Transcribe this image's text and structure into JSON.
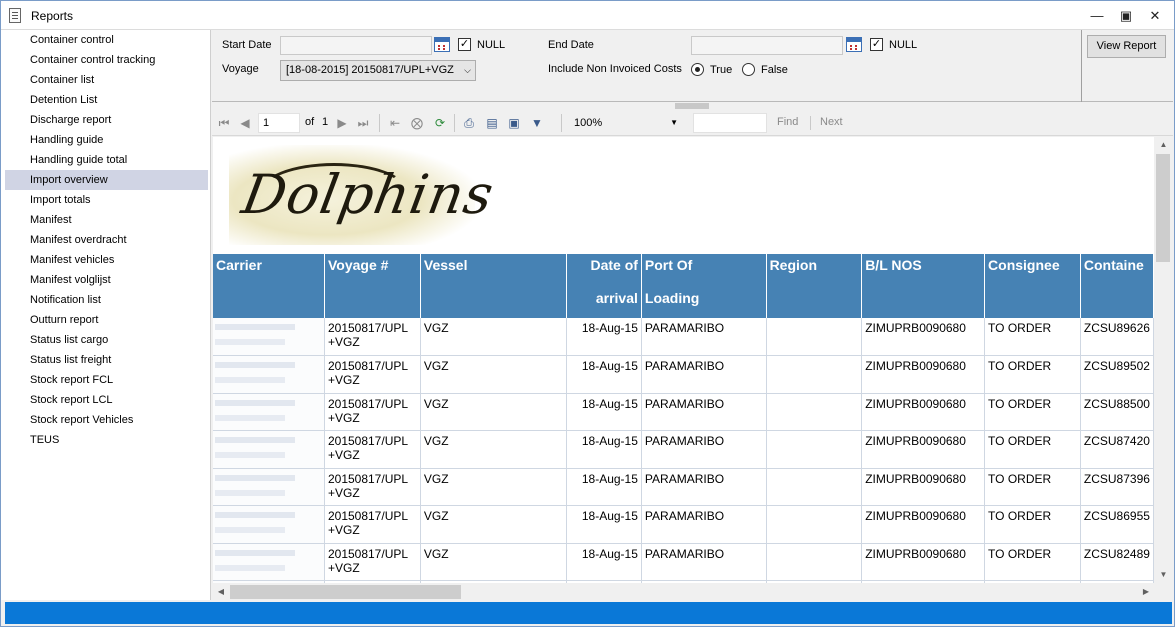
{
  "window": {
    "title": "Reports"
  },
  "sidebar": {
    "items": [
      {
        "label": "Container control"
      },
      {
        "label": "Container control tracking"
      },
      {
        "label": "Container list"
      },
      {
        "label": "Detention List"
      },
      {
        "label": "Discharge report"
      },
      {
        "label": "Handling guide"
      },
      {
        "label": "Handling guide total"
      },
      {
        "label": "Import overview",
        "selected": true
      },
      {
        "label": "Import totals"
      },
      {
        "label": "Manifest"
      },
      {
        "label": "Manifest overdracht"
      },
      {
        "label": "Manifest vehicles"
      },
      {
        "label": "Manifest volglijst"
      },
      {
        "label": "Notification list"
      },
      {
        "label": "Outturn report"
      },
      {
        "label": "Status list cargo"
      },
      {
        "label": "Status list freight"
      },
      {
        "label": "Stock report FCL"
      },
      {
        "label": "Stock report LCL"
      },
      {
        "label": "Stock report Vehicles"
      },
      {
        "label": "TEUS"
      }
    ]
  },
  "params": {
    "start_date_label": "Start Date",
    "start_date_value": "",
    "start_null_label": "NULL",
    "start_null_checked": true,
    "end_date_label": "End Date",
    "end_date_value": "",
    "end_null_label": "NULL",
    "end_null_checked": true,
    "voyage_label": "Voyage",
    "voyage_value": "[18-08-2015] 20150817/UPL+VGZ",
    "invoiced_label": "Include Non Invoiced Costs",
    "true_label": "True",
    "false_label": "False",
    "include_non_invoiced": true,
    "view_report_label": "View Report"
  },
  "toolbar": {
    "page_current": "1",
    "page_of_label": "of",
    "page_total": "1",
    "zoom": "100%",
    "find_value": "",
    "find_label": "Find",
    "next_label": "Next"
  },
  "report": {
    "logo_text": "Dolphins",
    "columns": [
      {
        "line1": "Carrier",
        "line2": ""
      },
      {
        "line1": "Voyage #",
        "line2": ""
      },
      {
        "line1": "Vessel",
        "line2": ""
      },
      {
        "line1": "Date of",
        "line2": "arrival"
      },
      {
        "line1": "Port Of",
        "line2": "Loading"
      },
      {
        "line1": "Region",
        "line2": ""
      },
      {
        "line1": "B/L NOS",
        "line2": ""
      },
      {
        "line1": "Consignee",
        "line2": ""
      },
      {
        "line1": "Containe",
        "line2": ""
      }
    ],
    "rows": [
      {
        "carrier": "",
        "voyage_l1": "20150817/UPL",
        "voyage_l2": "+VGZ",
        "vessel": "VGZ",
        "date": "18-Aug-15",
        "port": "PARAMARIBO",
        "region": "",
        "bl": "ZIMUPRB0090680",
        "consignee": "TO ORDER",
        "container": "ZCSU89626"
      },
      {
        "carrier": "",
        "voyage_l1": "20150817/UPL",
        "voyage_l2": "+VGZ",
        "vessel": "VGZ",
        "date": "18-Aug-15",
        "port": "PARAMARIBO",
        "region": "",
        "bl": "ZIMUPRB0090680",
        "consignee": "TO ORDER",
        "container": "ZCSU89502"
      },
      {
        "carrier": "",
        "voyage_l1": "20150817/UPL",
        "voyage_l2": "+VGZ",
        "vessel": "VGZ",
        "date": "18-Aug-15",
        "port": "PARAMARIBO",
        "region": "",
        "bl": "ZIMUPRB0090680",
        "consignee": "TO ORDER",
        "container": "ZCSU88500"
      },
      {
        "carrier": "",
        "voyage_l1": "20150817/UPL",
        "voyage_l2": "+VGZ",
        "vessel": "VGZ",
        "date": "18-Aug-15",
        "port": "PARAMARIBO",
        "region": "",
        "bl": "ZIMUPRB0090680",
        "consignee": "TO ORDER",
        "container": "ZCSU87420"
      },
      {
        "carrier": "",
        "voyage_l1": "20150817/UPL",
        "voyage_l2": "+VGZ",
        "vessel": "VGZ",
        "date": "18-Aug-15",
        "port": "PARAMARIBO",
        "region": "",
        "bl": "ZIMUPRB0090680",
        "consignee": "TO ORDER",
        "container": "ZCSU87396"
      },
      {
        "carrier": "",
        "voyage_l1": "20150817/UPL",
        "voyage_l2": "+VGZ",
        "vessel": "VGZ",
        "date": "18-Aug-15",
        "port": "PARAMARIBO",
        "region": "",
        "bl": "ZIMUPRB0090680",
        "consignee": "TO ORDER",
        "container": "ZCSU86955"
      },
      {
        "carrier": "",
        "voyage_l1": "20150817/UPL",
        "voyage_l2": "+VGZ",
        "vessel": "VGZ",
        "date": "18-Aug-15",
        "port": "PARAMARIBO",
        "region": "",
        "bl": "ZIMUPRB0090680",
        "consignee": "TO ORDER",
        "container": "ZCSU82489"
      },
      {
        "carrier": "",
        "voyage_l1": "",
        "voyage_l2": "",
        "vessel": "",
        "date": "",
        "port": "",
        "region": "",
        "bl": "",
        "consignee": "",
        "container": ""
      }
    ]
  },
  "colors": {
    "header_bg": "#4682b4",
    "status_bar": "#0a78d7",
    "selected_item": "#d0d4e4"
  },
  "icons": {
    "first": "first-page-icon",
    "prev": "prev-page-icon",
    "next": "next-page-icon",
    "last": "last-page-icon",
    "back": "back-icon",
    "stop": "stop-icon",
    "refresh": "refresh-icon",
    "print": "print-icon",
    "layout": "print-layout-icon",
    "page_setup": "page-setup-icon",
    "export": "export-icon"
  }
}
